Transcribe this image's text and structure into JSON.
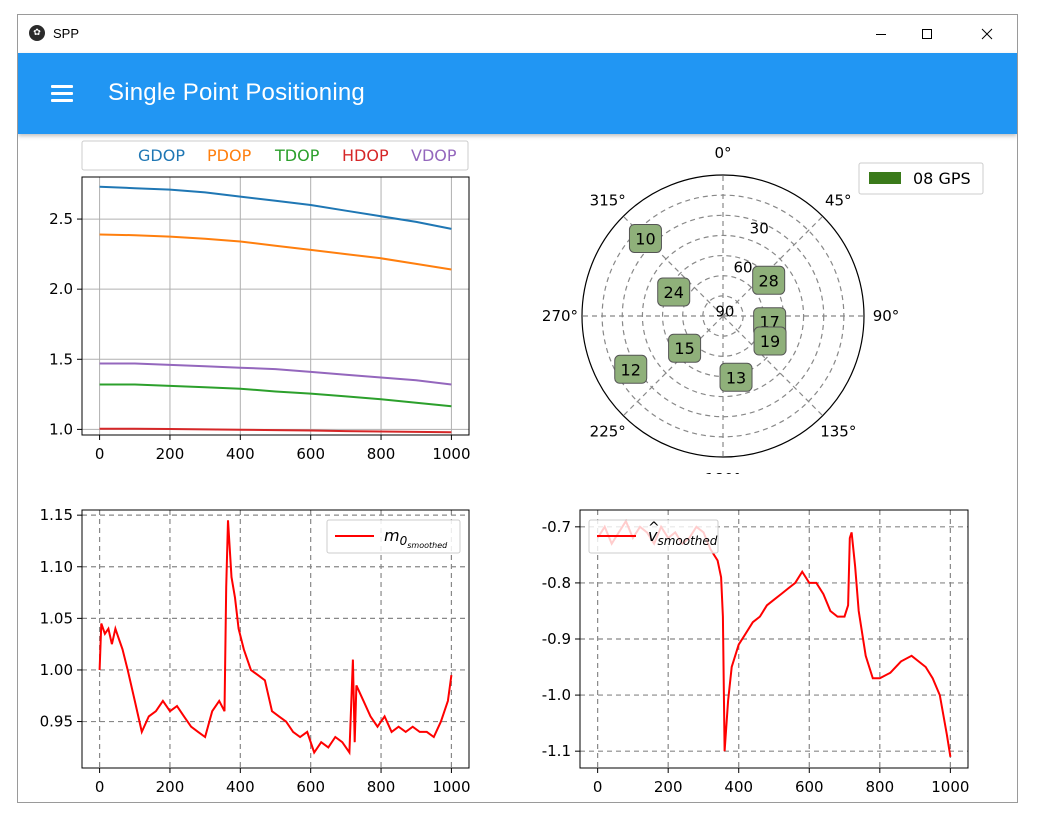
{
  "window": {
    "title": "SPP",
    "app_icon": "kivy-icon",
    "controls": [
      "minimize-icon",
      "maximize-icon",
      "close-icon"
    ]
  },
  "appbar": {
    "title": "Single Point Positioning",
    "menu_icon": "hamburger-menu-icon",
    "color": "#2196f3"
  },
  "chart_data": [
    {
      "type": "line",
      "legend": [
        "GDOP",
        "PDOP",
        "TDOP",
        "HDOP",
        "VDOP"
      ],
      "legend_placement": "top",
      "x": [
        0,
        100,
        200,
        300,
        400,
        500,
        600,
        700,
        800,
        900,
        1000
      ],
      "series": [
        {
          "name": "GDOP",
          "color": "#1f77b4",
          "values": [
            2.73,
            2.72,
            2.71,
            2.69,
            2.66,
            2.63,
            2.6,
            2.56,
            2.52,
            2.48,
            2.43
          ]
        },
        {
          "name": "PDOP",
          "color": "#ff7f0e",
          "values": [
            2.39,
            2.385,
            2.375,
            2.36,
            2.34,
            2.31,
            2.28,
            2.25,
            2.22,
            2.18,
            2.14
          ]
        },
        {
          "name": "TDOP",
          "color": "#2ca02c",
          "values": [
            1.32,
            1.32,
            1.31,
            1.3,
            1.29,
            1.27,
            1.255,
            1.235,
            1.215,
            1.19,
            1.165
          ]
        },
        {
          "name": "HDOP",
          "color": "#d62728",
          "values": [
            1.005,
            1.004,
            1.003,
            1.0,
            0.998,
            0.995,
            0.992,
            0.988,
            0.985,
            0.982,
            0.98
          ]
        },
        {
          "name": "VDOP",
          "color": "#9467bd",
          "values": [
            1.47,
            1.47,
            1.46,
            1.45,
            1.44,
            1.43,
            1.41,
            1.39,
            1.37,
            1.35,
            1.32
          ]
        }
      ],
      "xticks": [
        "0",
        "200",
        "400",
        "600",
        "800",
        "1000"
      ],
      "yticks": [
        "1.0",
        "1.5",
        "2.0",
        "2.5"
      ],
      "xlim": [
        -50,
        1050
      ],
      "ylim": [
        0.96,
        2.8
      ],
      "grid": true
    },
    {
      "type": "polar-skyplot",
      "legend": [
        "08 GPS"
      ],
      "legend_color": "#3a7a1a",
      "legend_placement": "top-right",
      "angle_labels": [
        "0°",
        "45°",
        "90°",
        "135°",
        "180°",
        "225°",
        "270°",
        "315°"
      ],
      "radial_labels": [
        "30",
        "60",
        "90"
      ],
      "satellites": [
        {
          "prn": "10",
          "azimuth": 315,
          "elevation": 20
        },
        {
          "prn": "28",
          "azimuth": 52,
          "elevation": 53
        },
        {
          "prn": "24",
          "azimuth": 296,
          "elevation": 55
        },
        {
          "prn": "17",
          "azimuth": 97,
          "elevation": 60
        },
        {
          "prn": "15",
          "azimuth": 230,
          "elevation": 58
        },
        {
          "prn": "19",
          "azimuth": 118,
          "elevation": 56
        },
        {
          "prn": "12",
          "azimuth": 240,
          "elevation": 22
        },
        {
          "prn": "13",
          "azimuth": 168,
          "elevation": 50
        }
      ],
      "marker_color": "#8fb07a"
    },
    {
      "type": "line",
      "legend": [
        "m0_smoothed"
      ],
      "legend_main": "m",
      "legend_sub": "0",
      "legend_subsub": "smoothed",
      "legend_placement": "top-right",
      "color": "#ff0000",
      "x": [
        0,
        5,
        15,
        25,
        35,
        45,
        55,
        65,
        80,
        100,
        120,
        140,
        160,
        180,
        200,
        220,
        240,
        260,
        280,
        300,
        320,
        340,
        355,
        360,
        365,
        375,
        385,
        395,
        410,
        430,
        450,
        470,
        490,
        510,
        530,
        550,
        570,
        590,
        610,
        630,
        650,
        670,
        690,
        710,
        720,
        725,
        730,
        750,
        770,
        790,
        810,
        830,
        850,
        870,
        890,
        910,
        930,
        950,
        970,
        990,
        1000
      ],
      "values": [
        1.0,
        1.045,
        1.035,
        1.04,
        1.025,
        1.04,
        1.03,
        1.02,
        1.0,
        0.97,
        0.94,
        0.955,
        0.96,
        0.97,
        0.96,
        0.965,
        0.955,
        0.945,
        0.94,
        0.935,
        0.96,
        0.97,
        0.96,
        1.08,
        1.145,
        1.09,
        1.07,
        1.04,
        1.02,
        1.0,
        0.995,
        0.99,
        0.96,
        0.955,
        0.95,
        0.94,
        0.935,
        0.94,
        0.92,
        0.93,
        0.925,
        0.935,
        0.93,
        0.92,
        1.01,
        0.93,
        0.985,
        0.97,
        0.955,
        0.945,
        0.955,
        0.94,
        0.945,
        0.94,
        0.945,
        0.94,
        0.94,
        0.935,
        0.95,
        0.97,
        0.995
      ],
      "xticks": [
        "0",
        "200",
        "400",
        "600",
        "800",
        "1000"
      ],
      "yticks": [
        "0.95",
        "1.00",
        "1.05",
        "1.10",
        "1.15"
      ],
      "xlim": [
        -50,
        1050
      ],
      "ylim": [
        0.905,
        1.155
      ],
      "grid": "dashed"
    },
    {
      "type": "line",
      "legend": [
        "v̂_smoothed"
      ],
      "legend_main": "v",
      "legend_sub": "smoothed",
      "legend_placement": "top-left",
      "color": "#ff0000",
      "x": [
        0,
        20,
        40,
        60,
        80,
        100,
        120,
        140,
        160,
        180,
        200,
        220,
        240,
        260,
        280,
        300,
        320,
        340,
        350,
        355,
        360,
        370,
        380,
        400,
        420,
        440,
        460,
        480,
        500,
        520,
        540,
        560,
        580,
        600,
        620,
        640,
        660,
        680,
        700,
        710,
        715,
        720,
        730,
        740,
        760,
        780,
        800,
        830,
        860,
        890,
        910,
        930,
        950,
        970,
        990,
        1000
      ],
      "values": [
        -0.72,
        -0.7,
        -0.73,
        -0.71,
        -0.69,
        -0.72,
        -0.7,
        -0.71,
        -0.73,
        -0.7,
        -0.72,
        -0.71,
        -0.73,
        -0.72,
        -0.7,
        -0.71,
        -0.74,
        -0.76,
        -0.79,
        -0.86,
        -1.1,
        -1.01,
        -0.95,
        -0.91,
        -0.89,
        -0.87,
        -0.86,
        -0.84,
        -0.83,
        -0.82,
        -0.81,
        -0.8,
        -0.78,
        -0.8,
        -0.8,
        -0.82,
        -0.85,
        -0.86,
        -0.86,
        -0.84,
        -0.72,
        -0.71,
        -0.77,
        -0.85,
        -0.93,
        -0.97,
        -0.97,
        -0.96,
        -0.94,
        -0.93,
        -0.94,
        -0.95,
        -0.97,
        -1.0,
        -1.07,
        -1.11
      ],
      "xticks": [
        "0",
        "200",
        "400",
        "600",
        "800",
        "1000"
      ],
      "yticks": [
        "-1.1",
        "-1.0",
        "-0.9",
        "-0.8",
        "-0.7"
      ],
      "xlim": [
        -50,
        1050
      ],
      "ylim": [
        -1.13,
        -0.67
      ],
      "grid": "dashed"
    }
  ]
}
